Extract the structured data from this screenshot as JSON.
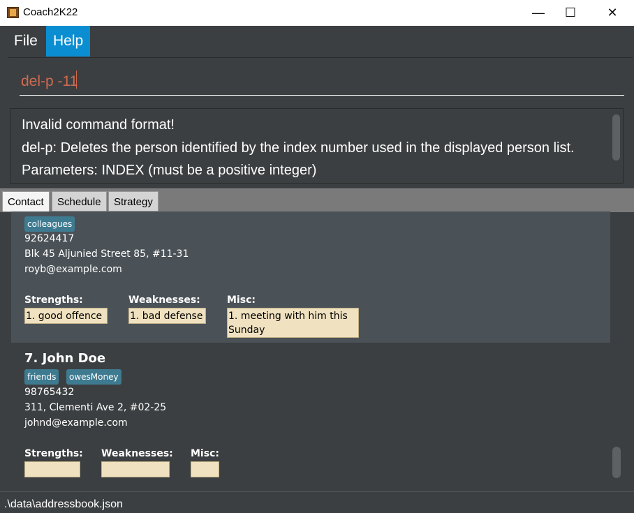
{
  "window": {
    "title": "Coach2K22",
    "minimize_glyph": "—",
    "maximize_glyph": "☐",
    "close_glyph": "✕"
  },
  "menu": {
    "file": "File",
    "help": "Help",
    "active_color": "#0b8ed1"
  },
  "command": {
    "value": "del-p -11"
  },
  "result": {
    "lines": [
      "Invalid command format!",
      "del-p: Deletes the person identified by the index number used in the displayed person list.",
      "Parameters: INDEX (must be a positive integer)"
    ]
  },
  "tabs": [
    {
      "label": "Contact"
    },
    {
      "label": "Schedule"
    },
    {
      "label": "Strategy"
    }
  ],
  "persons": [
    {
      "tags": [
        "colleagues"
      ],
      "phone": "92624417",
      "address": "Blk 45 Aljunied Street 85, #11-31",
      "email": "royb@example.com",
      "strengths_label": "Strengths:",
      "strengths": "1. good offence",
      "weaknesses_label": "Weaknesses:",
      "weaknesses": "1. bad defense",
      "misc_label": "Misc:",
      "misc": "1. meeting with him this Sunday"
    },
    {
      "index_name": "7.  John Doe",
      "tags": [
        "friends",
        "owesMoney"
      ],
      "phone": "98765432",
      "address": "311, Clementi Ave 2, #02-25",
      "email": "johnd@example.com",
      "strengths_label": "Strengths:",
      "strengths": "",
      "weaknesses_label": "Weaknesses:",
      "weaknesses": "",
      "misc_label": "Misc:",
      "misc": ""
    }
  ],
  "status": {
    "file_path": ".\\data\\addressbook.json"
  },
  "colors": {
    "tag_bg": "#3e7b91",
    "field_bg": "#f0e2c0",
    "command_text": "#d06a50"
  }
}
